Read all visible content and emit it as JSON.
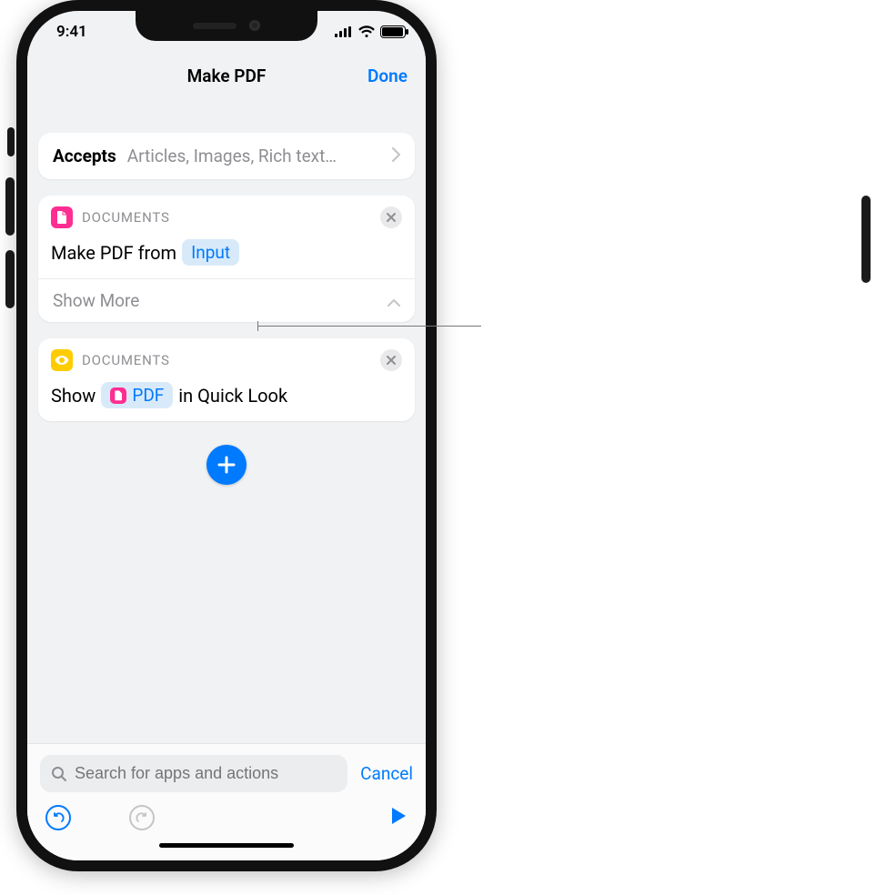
{
  "status": {
    "time": "9:41"
  },
  "nav": {
    "title": "Make PDF",
    "done": "Done"
  },
  "accepts": {
    "label": "Accepts",
    "value": "Articles, Images, Rich text…"
  },
  "action1": {
    "category": "DOCUMENTS",
    "line_prefix": "Make PDF from",
    "token": "Input",
    "show_more": "Show More"
  },
  "action2": {
    "category": "DOCUMENTS",
    "line_prefix": "Show",
    "token": "PDF",
    "line_suffix": "in Quick Look"
  },
  "bottom": {
    "search_placeholder": "Search for apps and actions",
    "cancel": "Cancel"
  }
}
